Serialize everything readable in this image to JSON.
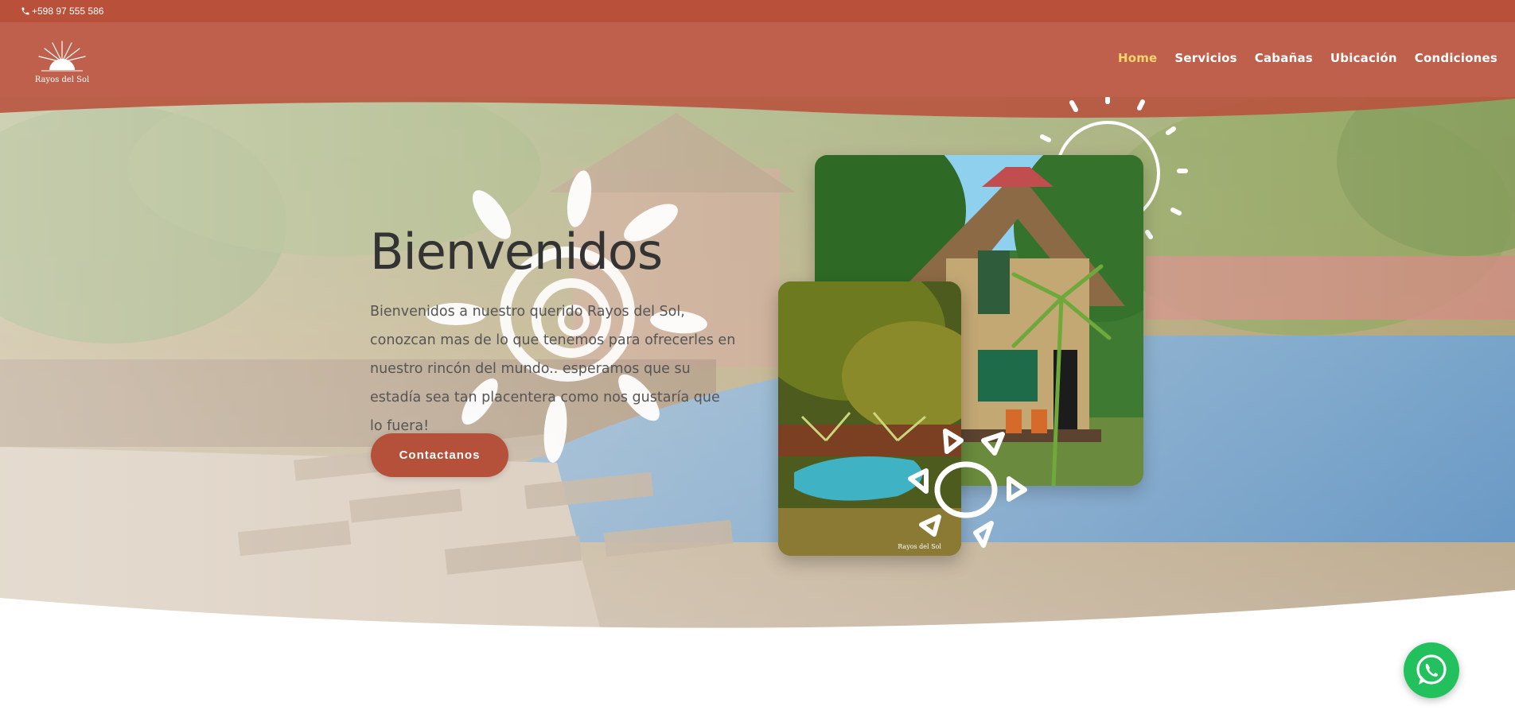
{
  "topbar": {
    "phone": "+598 97 555 586",
    "phone_icon": "phone-icon"
  },
  "header": {
    "logo_text": "Rayos del Sol",
    "nav": [
      {
        "label": "Home",
        "active": true
      },
      {
        "label": "Servicios",
        "active": false
      },
      {
        "label": "Cabañas",
        "active": false
      },
      {
        "label": "Ubicación",
        "active": false
      },
      {
        "label": "Condiciones",
        "active": false
      }
    ]
  },
  "hero": {
    "title": "Bienvenidos",
    "intro": "Bienvenidos a nuestro querido Rayos del Sol, conozcan mas de lo que tenemos para ofrecerles en nuestro rincón del mundo.. esperamos que su estadía sea tan placentera como nos gustaría que lo fuera!",
    "cta_label": "Contactanos",
    "photo_watermark": "Rayos del Sol"
  },
  "floating": {
    "icon": "whatsapp-icon"
  },
  "colors": {
    "brand": "#b8503a",
    "nav_active": "#f5d46b",
    "button": "#b5503a",
    "whatsapp": "#22c15e"
  }
}
